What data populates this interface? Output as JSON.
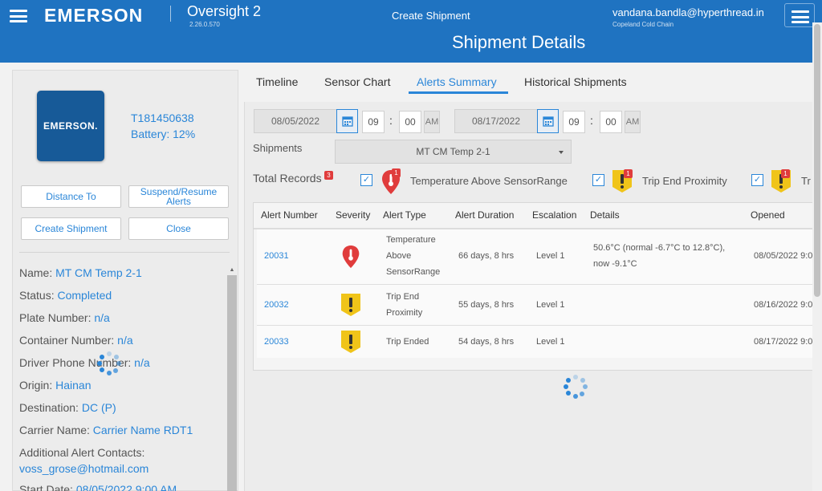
{
  "header": {
    "brand": "EMERSON",
    "app_name": "Oversight 2",
    "app_version": "2.26.0.570",
    "nav_title": "Create Shipment",
    "user_email": "vandana.bandla@hyperthread.in",
    "user_org": "Copeland Cold Chain",
    "page_title": "Shipment Details"
  },
  "device": {
    "logo_text": "EMERSON.",
    "id": "T181450638",
    "battery": "Battery: 12%"
  },
  "actions": {
    "distance_to": "Distance To",
    "suspend_resume": "Suspend/Resume Alerts",
    "create_shipment": "Create Shipment",
    "close": "Close"
  },
  "info": [
    {
      "label": "Name: ",
      "value": "MT CM Temp 2-1"
    },
    {
      "label": "Status: ",
      "value": "Completed"
    },
    {
      "label": "Plate Number: ",
      "value": "n/a"
    },
    {
      "label": "Container Number: ",
      "value": "n/a"
    },
    {
      "label": "Driver Phone Number: ",
      "value": "n/a"
    },
    {
      "label": "Origin: ",
      "value": "Hainan"
    },
    {
      "label": "Destination: ",
      "value": "DC (P)"
    },
    {
      "label": "Carrier Name: ",
      "value": "Carrier Name RDT1"
    },
    {
      "label": "Additional Alert Contacts:",
      "value": "voss_grose@hotmail.com"
    },
    {
      "label": "Start Date: ",
      "value": "08/05/2022 9:00 AM"
    }
  ],
  "tabs": [
    {
      "label": "Timeline"
    },
    {
      "label": "Sensor Chart"
    },
    {
      "label": "Alerts Summary"
    },
    {
      "label": "Historical Shipments"
    }
  ],
  "filters": {
    "start_date": "08/05/2022",
    "start_hour": "09",
    "start_minute": "00",
    "start_ampm": "AM",
    "end_date": "08/17/2022",
    "end_hour": "09",
    "end_minute": "00",
    "end_ampm": "AM",
    "time_separator": ":",
    "shipments_label": "Shipments",
    "shipments_value": "MT CM Temp 2-1",
    "total_records_label": "Total Records",
    "total_records_count": "3",
    "alert_filters": [
      {
        "label": "Temperature Above SensorRange",
        "count": "1",
        "checked": true,
        "icon": "thermometer-alert-icon"
      },
      {
        "label": "Trip End Proximity",
        "count": "1",
        "checked": true,
        "icon": "warning-shield-icon"
      },
      {
        "label": "Tr",
        "count": "1",
        "checked": true,
        "icon": "warning-shield-icon"
      }
    ]
  },
  "table": {
    "columns": [
      "Alert Number",
      "Severity",
      "Alert Type",
      "Alert Duration",
      "Escalation",
      "Details",
      "Opened"
    ],
    "rows": [
      {
        "number": "20031",
        "severity": "thermometer-alert-icon",
        "type": [
          "Temperature",
          "Above",
          "SensorRange"
        ],
        "duration": "66 days, 8 hrs",
        "escalation": "Level 1",
        "details": [
          "50.6°C (normal -6.7°C to 12.8°C),",
          "now -9.1°C"
        ],
        "opened": "08/05/2022 9:0"
      },
      {
        "number": "20032",
        "severity": "warning-shield-icon",
        "type": [
          "Trip End",
          "Proximity"
        ],
        "duration": "55 days, 8 hrs",
        "escalation": "Level 1",
        "details": [],
        "opened": "08/16/2022 9:0"
      },
      {
        "number": "20033",
        "severity": "warning-shield-icon",
        "type": [
          "Trip Ended"
        ],
        "duration": "54 days, 8 hrs",
        "escalation": "Level 1",
        "details": [],
        "opened": "08/17/2022 9:0"
      }
    ]
  },
  "colors": {
    "header_blue": "#1f73c1",
    "link_blue": "#2a86d8",
    "alert_red": "#e03c3c",
    "warning_yellow": "#f0c419"
  }
}
